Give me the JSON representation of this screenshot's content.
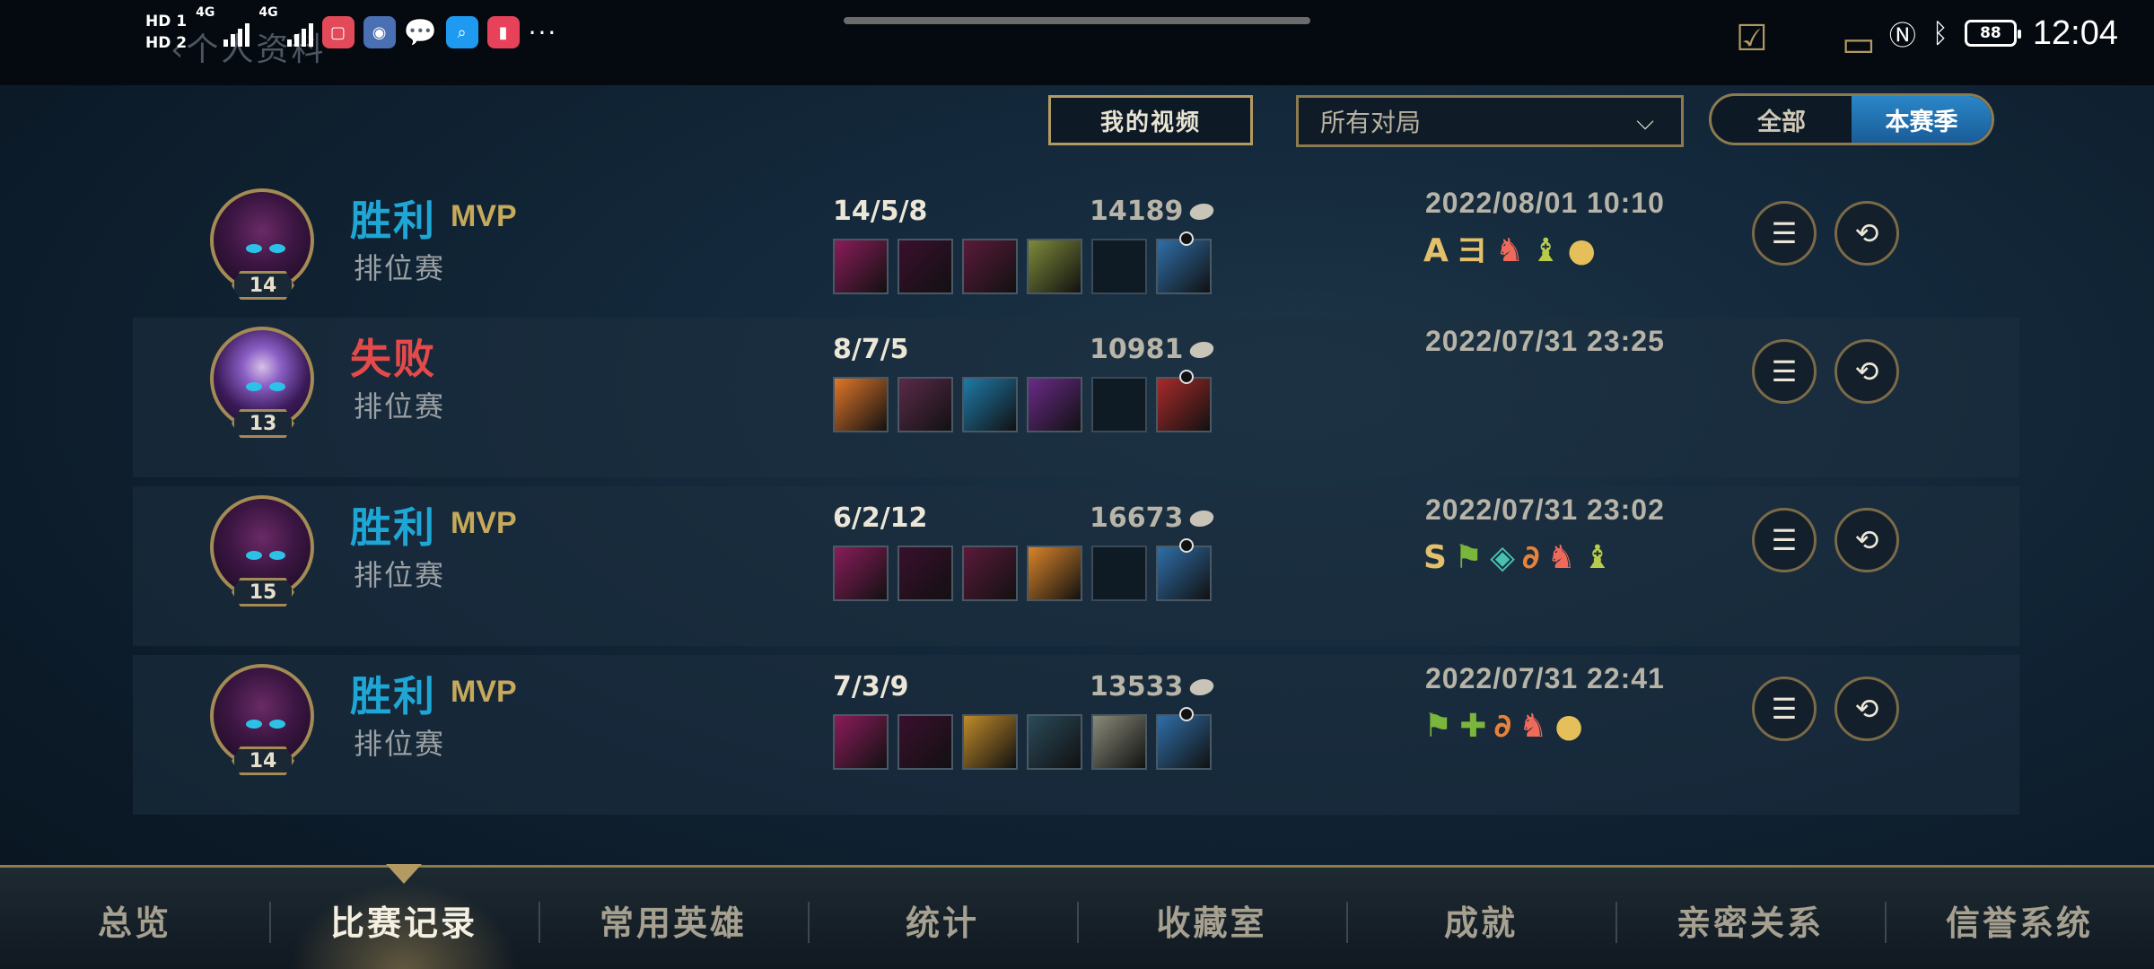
{
  "status_bar": {
    "sim1": "HD 1",
    "sim2": "HD 2",
    "net": "4G",
    "time": "12:04",
    "battery": "88"
  },
  "page": {
    "title": "个人资料"
  },
  "filters": {
    "video_label": "我的视频",
    "dropdown_value": "所有对局",
    "toggle_all": "全部",
    "toggle_season": "本赛季"
  },
  "matches": [
    {
      "result": "胜利",
      "mvp": "MVP",
      "mode": "排位赛",
      "level": "14",
      "kda": "14/5/8",
      "gold": "14189",
      "date": "2022/08/01 10:10",
      "badges": [
        "A",
        "ヨ",
        "♞",
        "♝",
        "●"
      ]
    },
    {
      "result": "失败",
      "mvp": "",
      "mode": "排位赛",
      "level": "13",
      "kda": "8/7/5",
      "gold": "10981",
      "date": "2022/07/31 23:25",
      "badges": []
    },
    {
      "result": "胜利",
      "mvp": "MVP",
      "mode": "排位赛",
      "level": "15",
      "kda": "6/2/12",
      "gold": "16673",
      "date": "2022/07/31 23:02",
      "badges": [
        "S",
        "⚑",
        "◈",
        "∂",
        "♞",
        "♝"
      ]
    },
    {
      "result": "胜利",
      "mvp": "MVP",
      "mode": "排位赛",
      "level": "14",
      "kda": "7/3/9",
      "gold": "13533",
      "date": "2022/07/31 22:41",
      "badges": [
        "⚑",
        "✚",
        "∂",
        "♞",
        "●"
      ]
    }
  ],
  "tabs": [
    "总览",
    "比赛记录",
    "常用英雄",
    "统计",
    "收藏室",
    "成就",
    "亲密关系",
    "信誉系统"
  ],
  "colors": {
    "win": "#1ea7d6",
    "lose": "#e44a4a",
    "accent": "#b39a63",
    "toggle_active": "#2a86c8"
  }
}
